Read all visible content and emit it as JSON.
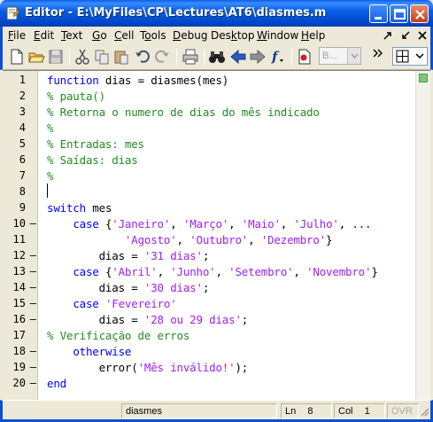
{
  "window": {
    "title": "Editor - E:\\MyFiles\\CP\\Lectures\\AT6\\diasmes.m"
  },
  "menu": [
    "File",
    "Edit",
    "Text",
    "Go",
    "Cell",
    "Tools",
    "Debug",
    "Desktop",
    "Window",
    "Help"
  ],
  "menu_underline": [
    "F",
    "E",
    "T",
    "G",
    "C",
    "o",
    "D",
    "k",
    "W",
    "H"
  ],
  "toolbar": {
    "font_combo": "B...",
    "icons": [
      "new-file-icon",
      "open-folder-icon",
      "save-icon",
      "cut-icon",
      "copy-icon",
      "paste-icon",
      "undo-icon",
      "redo-icon",
      "print-icon",
      "find-icon",
      "back-icon",
      "forward-icon",
      "function-icon",
      "breakpoint-icon",
      "layout-icon"
    ]
  },
  "editor": {
    "line_numbers": [
      "1",
      "2",
      "3",
      "4",
      "5",
      "6",
      "7",
      "8",
      "9",
      "10",
      "11",
      "12",
      "13",
      "14",
      "15",
      "16",
      "17",
      "18",
      "19",
      "20"
    ],
    "breakpoint_dash_lines": [
      10,
      12,
      13,
      14,
      15,
      16,
      18,
      19,
      20
    ],
    "lines": [
      [
        {
          "t": "function",
          "c": "k"
        },
        {
          "t": " dias = diasmes(mes)",
          "c": ""
        }
      ],
      [
        {
          "t": "% pauta()",
          "c": "c"
        }
      ],
      [
        {
          "t": "% Retorna o numero de dias do mês indicado",
          "c": "c"
        }
      ],
      [
        {
          "t": "%",
          "c": "c"
        }
      ],
      [
        {
          "t": "% Entradas: mes",
          "c": "c"
        }
      ],
      [
        {
          "t": "% Saídas: dias",
          "c": "c"
        }
      ],
      [
        {
          "t": "%",
          "c": "c"
        }
      ],
      [],
      [
        {
          "t": "switch",
          "c": "k"
        },
        {
          "t": " mes",
          "c": ""
        }
      ],
      [
        {
          "t": "    ",
          "c": ""
        },
        {
          "t": "case",
          "c": "k"
        },
        {
          "t": " {",
          "c": ""
        },
        {
          "t": "'Janeiro'",
          "c": "s"
        },
        {
          "t": ", ",
          "c": ""
        },
        {
          "t": "'Março'",
          "c": "s"
        },
        {
          "t": ", ",
          "c": ""
        },
        {
          "t": "'Maio'",
          "c": "s"
        },
        {
          "t": ", ",
          "c": ""
        },
        {
          "t": "'Julho'",
          "c": "s"
        },
        {
          "t": ", ",
          "c": ""
        },
        {
          "t": "...",
          "c": "k"
        }
      ],
      [
        {
          "t": "            ",
          "c": ""
        },
        {
          "t": "'Agosto'",
          "c": "s"
        },
        {
          "t": ", ",
          "c": ""
        },
        {
          "t": "'Outubro'",
          "c": "s"
        },
        {
          "t": ", ",
          "c": ""
        },
        {
          "t": "'Dezembro'",
          "c": "s"
        },
        {
          "t": "}",
          "c": ""
        }
      ],
      [
        {
          "t": "        dias = ",
          "c": ""
        },
        {
          "t": "'31 dias'",
          "c": "s"
        },
        {
          "t": ";",
          "c": ""
        }
      ],
      [
        {
          "t": "    ",
          "c": ""
        },
        {
          "t": "case",
          "c": "k"
        },
        {
          "t": " {",
          "c": ""
        },
        {
          "t": "'Abril'",
          "c": "s"
        },
        {
          "t": ", ",
          "c": ""
        },
        {
          "t": "'Junho'",
          "c": "s"
        },
        {
          "t": ", ",
          "c": ""
        },
        {
          "t": "'Setembro'",
          "c": "s"
        },
        {
          "t": ", ",
          "c": ""
        },
        {
          "t": "'Novembro'",
          "c": "s"
        },
        {
          "t": "}",
          "c": ""
        }
      ],
      [
        {
          "t": "        dias = ",
          "c": ""
        },
        {
          "t": "'30 dias'",
          "c": "s"
        },
        {
          "t": ";",
          "c": ""
        }
      ],
      [
        {
          "t": "    ",
          "c": ""
        },
        {
          "t": "case",
          "c": "k"
        },
        {
          "t": " ",
          "c": ""
        },
        {
          "t": "'Fevereiro'",
          "c": "s"
        }
      ],
      [
        {
          "t": "        dias = ",
          "c": ""
        },
        {
          "t": "'28 ou 29 dias'",
          "c": "s"
        },
        {
          "t": ";",
          "c": ""
        }
      ],
      [
        {
          "t": "% Verificação de erros",
          "c": "c"
        }
      ],
      [
        {
          "t": "    ",
          "c": ""
        },
        {
          "t": "otherwise",
          "c": "k"
        }
      ],
      [
        {
          "t": "        error(",
          "c": ""
        },
        {
          "t": "'Mês inválido!'",
          "c": "s"
        },
        {
          "t": ");",
          "c": ""
        }
      ],
      [
        {
          "t": "end",
          "c": "k"
        }
      ]
    ]
  },
  "status": {
    "function_name": "diasmes",
    "ln_label": "Ln",
    "ln_value": "8",
    "col_label": "Col",
    "col_value": "1",
    "ovr": "OVR"
  },
  "colors": {
    "keyword": "#0000ff",
    "comment": "#228b22",
    "string": "#a020f0",
    "titlebar": "#0a5fe6"
  }
}
